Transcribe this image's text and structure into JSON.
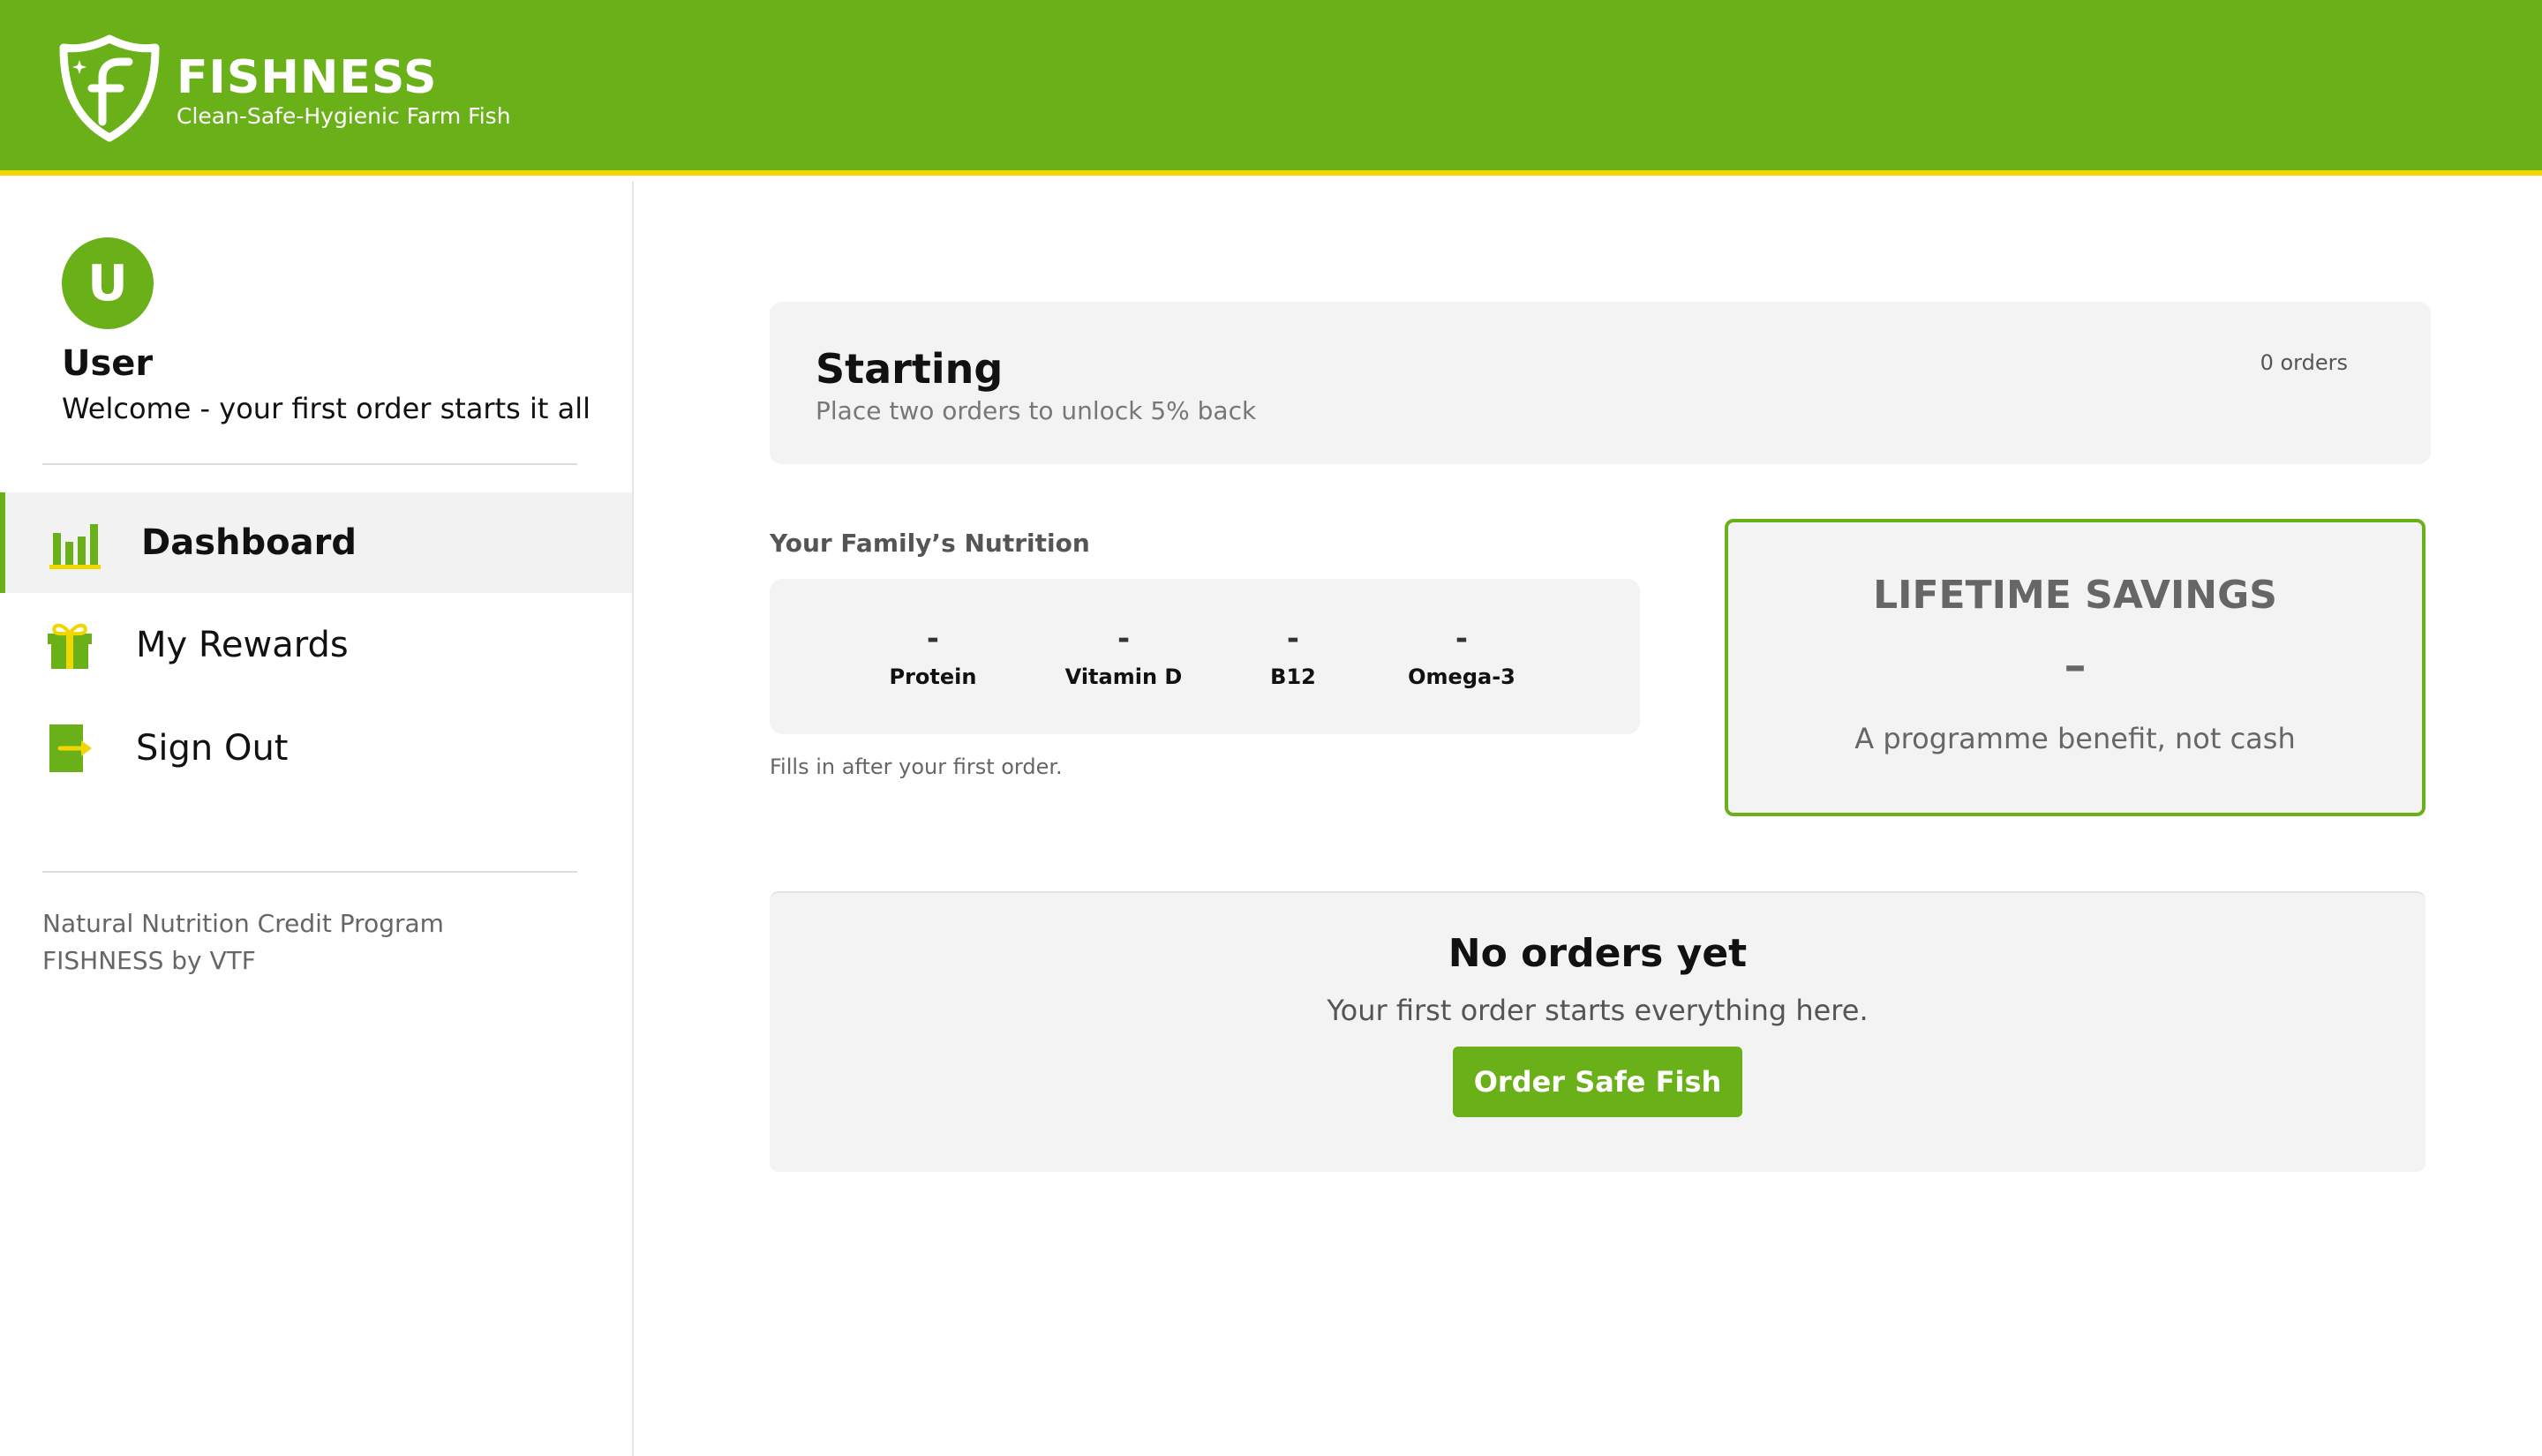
{
  "header": {
    "brand_name": "FISHNESS",
    "tagline": "Clean-Safe-Hygienic Farm Fish",
    "logo_icon": "shield-f-logo",
    "background_color": "#6ab018",
    "accent_color": "#f2d600"
  },
  "sidebar": {
    "avatar_initial": "U",
    "user_name": "User",
    "welcome": "Welcome - your first order starts it all",
    "nav": [
      {
        "label": "Dashboard",
        "icon": "bar-chart-icon",
        "active": true
      },
      {
        "label": "My Rewards",
        "icon": "gift-icon",
        "active": false
      },
      {
        "label": "Sign Out",
        "icon": "sign-out-icon",
        "active": false
      }
    ],
    "footer_line1": "Natural Nutrition Credit Program",
    "footer_line2": "FISHNESS by VTF"
  },
  "status": {
    "title": "Starting",
    "subtitle": "Place two orders to unlock 5% back",
    "order_count": "0 orders"
  },
  "nutrition": {
    "heading": "Your Family’s Nutrition",
    "items": [
      {
        "value": "-",
        "label": "Protein"
      },
      {
        "value": "-",
        "label": "Vitamin D"
      },
      {
        "value": "-",
        "label": "B12"
      },
      {
        "value": "-",
        "label": "Omega-3"
      }
    ],
    "note": "Fills in after your first order."
  },
  "savings": {
    "title": "LIFETIME SAVINGS",
    "value": "–",
    "note": "A programme benefit, not cash"
  },
  "orders": {
    "title": "No orders yet",
    "subtitle": "Your first order starts everything here.",
    "button_label": "Order Safe Fish"
  }
}
